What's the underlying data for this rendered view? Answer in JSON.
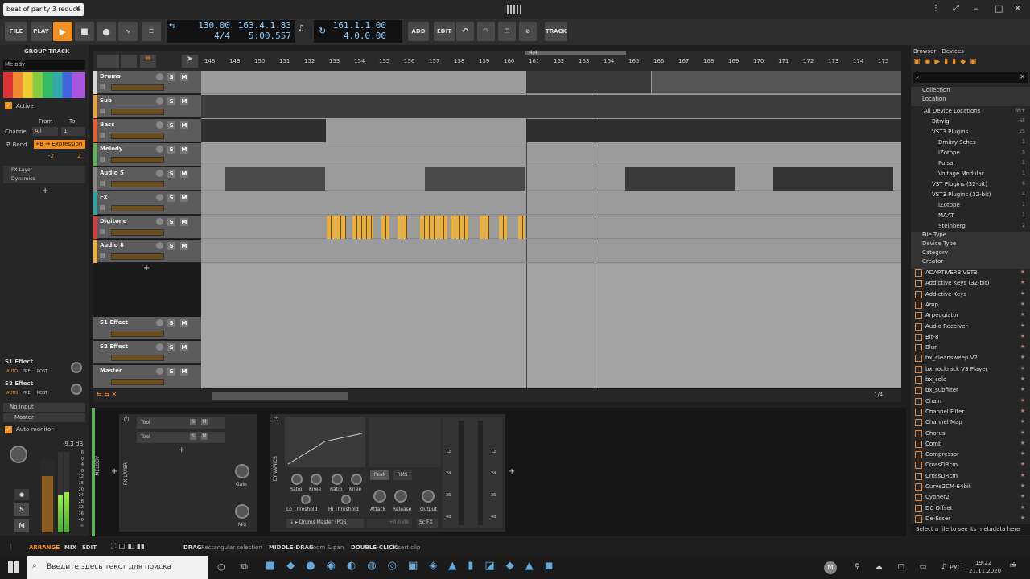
{
  "window": {
    "tab_title": "beat of parity 3 reduce"
  },
  "toolbar": {
    "file": "FILE",
    "play": "PLAY",
    "add": "ADD",
    "edit": "EDIT",
    "track": "TRACK",
    "tempo": "130.00",
    "sig": "4/4",
    "position": "163.4.1.83",
    "time": "5:00.557",
    "loop_start": "161.1.1.00",
    "loop_len": "4.0.0.00"
  },
  "left": {
    "header": "GROUP TRACK",
    "name": "Melody",
    "active": "Active",
    "from": "From",
    "to": "To",
    "channel": "Channel",
    "channel_val": "All",
    "to_val": "1",
    "pbend": "P. Bend",
    "pb_expr": "PB → Expression",
    "pb_lo": "-2",
    "pb_hi": "2",
    "fx_layer": "FX Layer",
    "dynamics": "Dynamics",
    "s1": "S1 Effect",
    "s2": "S2 Effect",
    "auto": "AUTO",
    "pre": "PRE",
    "post": "POST",
    "no_input": "No input",
    "master": "Master",
    "automon": "Auto-monitor",
    "db": "-9.3 dB",
    "scale": [
      "6",
      "0",
      "4",
      "8",
      "12",
      "16",
      "20",
      "24",
      "28",
      "32",
      "36",
      "40",
      "∞"
    ],
    "s": "S",
    "m": "M"
  },
  "tracks": [
    {
      "name": "Drums",
      "color": "#d8d8d8"
    },
    {
      "name": "Sub",
      "color": "#e8a040"
    },
    {
      "name": "Bass",
      "color": "#e06030"
    },
    {
      "name": "Melody",
      "color": "#60b060"
    },
    {
      "name": "Audio 5",
      "color": "#888888"
    },
    {
      "name": "Fx",
      "color": "#30a0a0"
    },
    {
      "name": "Digitone",
      "color": "#d04040"
    },
    {
      "name": "Audio 8",
      "color": "#e8b040"
    }
  ],
  "returns": [
    {
      "name": "S1 Effect"
    },
    {
      "name": "S2 Effect"
    },
    {
      "name": "Master"
    }
  ],
  "ruler": [
    "148",
    "149",
    "150",
    "151",
    "152",
    "153",
    "154",
    "155",
    "156",
    "157",
    "158",
    "159",
    "160",
    "161",
    "162",
    "163",
    "164",
    "165",
    "166",
    "167",
    "168",
    "169",
    "170",
    "171",
    "172",
    "173",
    "174",
    "175"
  ],
  "ruler_sig": "4/4",
  "zoom": "1/4",
  "browser": {
    "title": "Browser - Devices",
    "sections": [
      "Collection",
      "Location"
    ],
    "locations": [
      {
        "label": "All Device Locations",
        "count": "66+"
      },
      {
        "label": "Bitwig",
        "count": "65"
      },
      {
        "label": "VST3 Plugins",
        "count": "25"
      },
      {
        "label": "Dmitry Sches",
        "count": "1"
      },
      {
        "label": "iZotope",
        "count": "5"
      },
      {
        "label": "Pulsar",
        "count": "1"
      },
      {
        "label": "Voltage Modular",
        "count": "1"
      },
      {
        "label": "VST Plugins (32-bit)",
        "count": "6"
      },
      {
        "label": "VST3 Plugins (32-bit)",
        "count": "4"
      },
      {
        "label": "iZotope",
        "count": "1"
      },
      {
        "label": "MAAT",
        "count": "1"
      },
      {
        "label": "Steinberg",
        "count": "2"
      }
    ],
    "filters": [
      "File Type",
      "Device Type",
      "Category",
      "Creator"
    ],
    "devices": [
      "ADAPTIVERB VST3",
      "Addictive Keys (32-bit)",
      "Addictive Keys",
      "Amp",
      "Arpeggiator",
      "Audio Receiver",
      "Bit-8",
      "Blur",
      "bx_cleansweep V2",
      "bx_rockrack V3 Player",
      "bx_solo",
      "bx_subfilter",
      "Chain",
      "Channel Filter",
      "Channel Map",
      "Chorus",
      "Comb",
      "Compressor",
      "CrossDRcm",
      "CrossDRcm",
      "Curve2CM-64bit",
      "Cypher2",
      "DC Offset",
      "De-Esser"
    ],
    "footer": "Select a file to see its metadata here"
  },
  "device_panel": {
    "track": "MELODY",
    "fx_layer": "FX LAYER",
    "tool1": "Tool",
    "tool2": "Tool",
    "gain": "Gain",
    "mix": "Mix",
    "dynamics": "DYNAMICS",
    "ratio": "Ratio",
    "knee": "Knee",
    "lo_thr": "Lo Threshold",
    "hi_thr": "Hi Threshold",
    "peak": "Peak",
    "rms": "RMS",
    "attack": "Attack",
    "release": "Release",
    "output": "Output",
    "sidechain": "Drums Master (POS",
    "sc_db": "+0.0 dB",
    "scfx": "Sc FX",
    "meter_scale": [
      "12",
      "24",
      "36",
      "48"
    ]
  },
  "status": {
    "arrange": "ARRANGE",
    "mix": "MIX",
    "edit": "EDIT",
    "drag": "DRAG",
    "drag_d": "Rectangular selection",
    "mdrag": "MIDDLE-DRAG",
    "mdrag_d": "Zoom & pan",
    "dclick": "DOUBLE-CLICK",
    "dclick_d": "Insert clip"
  },
  "taskbar": {
    "search": "Введите здесь текст для поиска",
    "lang": "РУС",
    "time": "19:22",
    "date": "21.11.2020",
    "notif": "6",
    "user": "M"
  }
}
